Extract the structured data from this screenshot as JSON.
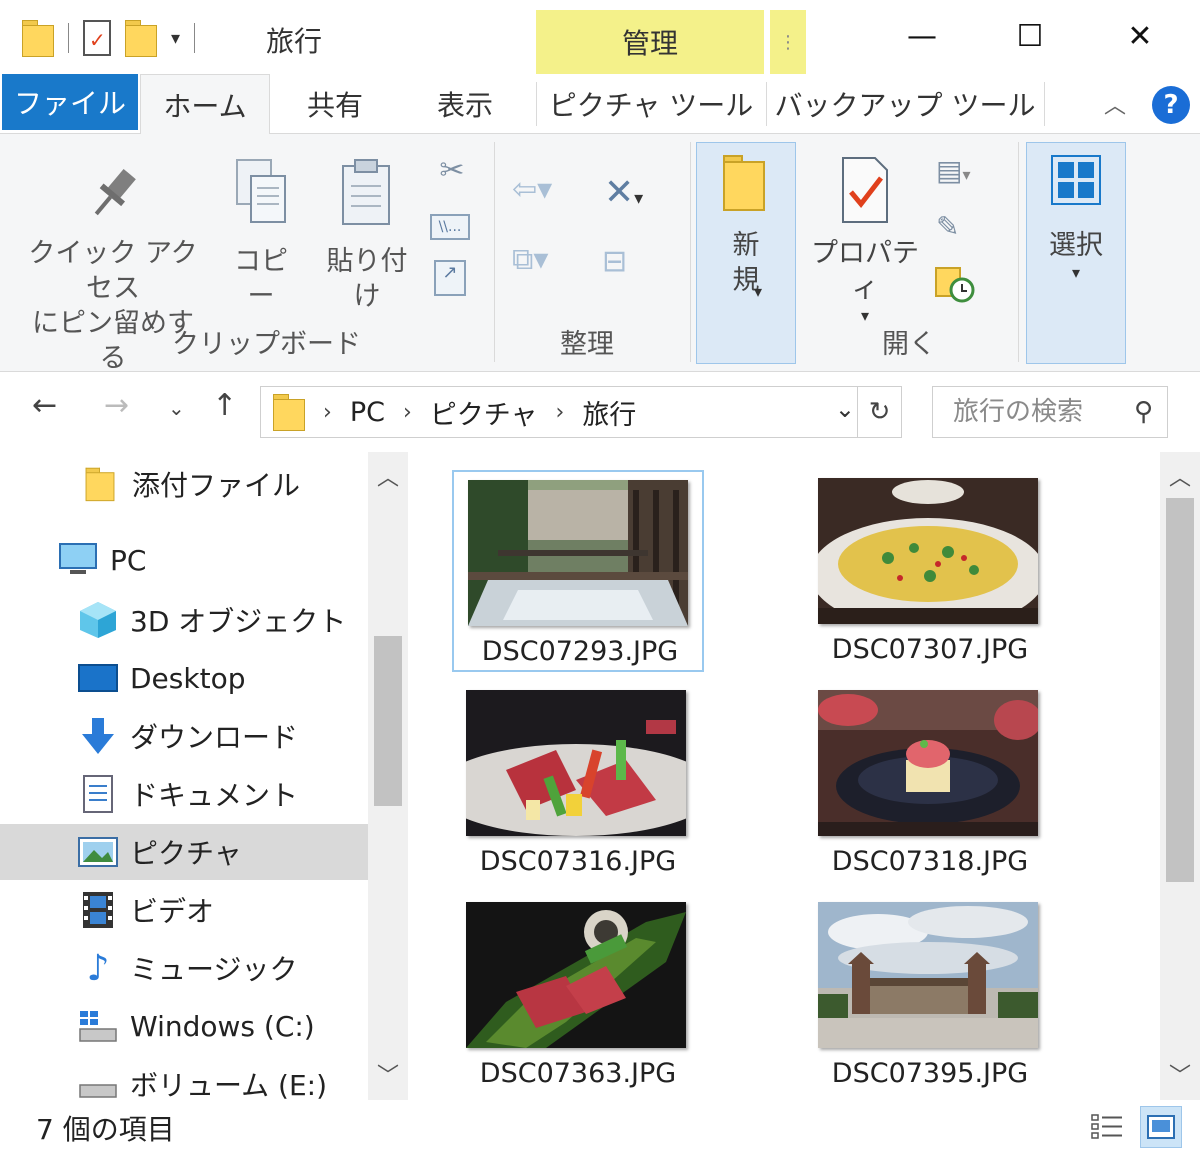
{
  "window": {
    "title": "旅行",
    "contextual_tab": "管理",
    "minimize": "—",
    "maximize": "☐",
    "close": "✕"
  },
  "tabs": {
    "file": "ファイル",
    "home": "ホーム",
    "share": "共有",
    "view": "表示",
    "picture_tools": "ピクチャ ツール",
    "backup_tools": "バックアップ ツール",
    "help": "?"
  },
  "ribbon": {
    "pin_line1": "クイック アクセス",
    "pin_line2": "にピン留めする",
    "copy": "コピー",
    "paste": "貼り付け",
    "clipboard_group": "クリップボード",
    "organize_group": "整理",
    "new_line1": "新",
    "new_line2": "規",
    "properties": "プロパティ",
    "open_group": "開く",
    "select": "選択"
  },
  "address": {
    "crumbs": [
      "PC",
      "ピクチャ",
      "旅行"
    ],
    "search_placeholder": "旅行の検索"
  },
  "nav": {
    "items": [
      {
        "label": "添付ファイル",
        "icon": "folder-icon"
      },
      {
        "label": "PC",
        "icon": "pc-icon"
      },
      {
        "label": "3D オブジェクト",
        "icon": "3d-objects-icon"
      },
      {
        "label": "Desktop",
        "icon": "desktop-icon"
      },
      {
        "label": "ダウンロード",
        "icon": "download-icon"
      },
      {
        "label": "ドキュメント",
        "icon": "documents-icon"
      },
      {
        "label": "ピクチャ",
        "icon": "pictures-icon"
      },
      {
        "label": "ビデオ",
        "icon": "video-icon"
      },
      {
        "label": "ミュージック",
        "icon": "music-icon"
      },
      {
        "label": "Windows (C:)",
        "icon": "drive-icon"
      },
      {
        "label": "ボリューム (E:)",
        "icon": "drive-icon"
      }
    ],
    "selected": "ピクチャ"
  },
  "files": [
    {
      "name": "DSC07293.JPG",
      "subject": "balcony-bath-photo"
    },
    {
      "name": "DSC07307.JPG",
      "subject": "salad-dish-photo"
    },
    {
      "name": "DSC07316.JPG",
      "subject": "beef-vegetables-photo"
    },
    {
      "name": "DSC07318.JPG",
      "subject": "appetizer-bowl-photo"
    },
    {
      "name": "DSC07363.JPG",
      "subject": "beef-leaf-photo"
    },
    {
      "name": "DSC07395.JPG",
      "subject": "building-sky-photo"
    }
  ],
  "status": {
    "item_count": "7 個の項目"
  },
  "colors": {
    "file_tab": "#1979ca",
    "contextual_tab": "#f4f18a",
    "selection": "#d9d9d9",
    "help": "#1a6dd6"
  }
}
